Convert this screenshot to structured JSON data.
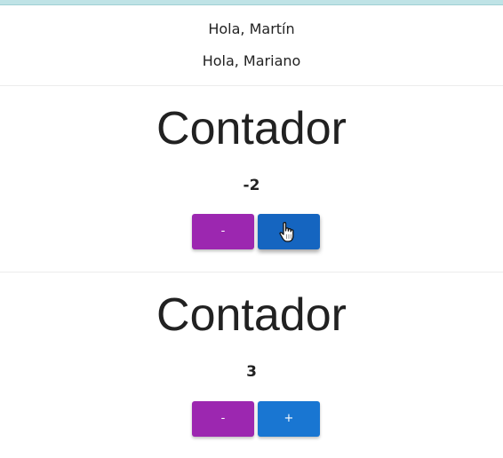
{
  "greetings": [
    "Hola, Martín",
    "Hola, Mariano"
  ],
  "counters": [
    {
      "title": "Contador",
      "value": "-2",
      "decrement_label": "-",
      "increment_label": "+"
    },
    {
      "title": "Contador",
      "value": "3",
      "decrement_label": "-",
      "increment_label": "+"
    }
  ],
  "colors": {
    "decrement_button": "#9c27b0",
    "increment_button": "#1976d2",
    "increment_button_hover": "#1565c0"
  },
  "cursor_icon": "hand-pointer-icon"
}
